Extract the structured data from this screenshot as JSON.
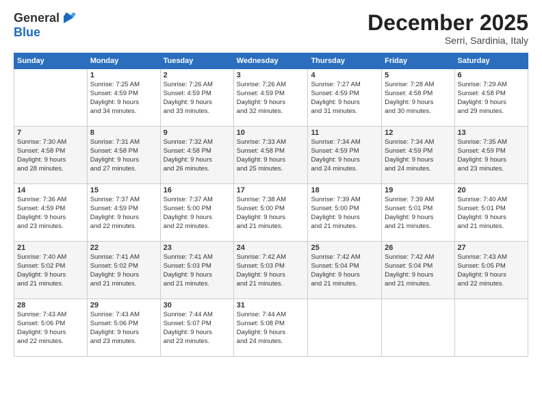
{
  "header": {
    "logo_line1": "General",
    "logo_line2": "Blue",
    "month": "December 2025",
    "location": "Serri, Sardinia, Italy"
  },
  "weekdays": [
    "Sunday",
    "Monday",
    "Tuesday",
    "Wednesday",
    "Thursday",
    "Friday",
    "Saturday"
  ],
  "weeks": [
    [
      {
        "day": "",
        "info": ""
      },
      {
        "day": "1",
        "info": "Sunrise: 7:25 AM\nSunset: 4:59 PM\nDaylight: 9 hours\nand 34 minutes."
      },
      {
        "day": "2",
        "info": "Sunrise: 7:26 AM\nSunset: 4:59 PM\nDaylight: 9 hours\nand 33 minutes."
      },
      {
        "day": "3",
        "info": "Sunrise: 7:26 AM\nSunset: 4:59 PM\nDaylight: 9 hours\nand 32 minutes."
      },
      {
        "day": "4",
        "info": "Sunrise: 7:27 AM\nSunset: 4:59 PM\nDaylight: 9 hours\nand 31 minutes."
      },
      {
        "day": "5",
        "info": "Sunrise: 7:28 AM\nSunset: 4:58 PM\nDaylight: 9 hours\nand 30 minutes."
      },
      {
        "day": "6",
        "info": "Sunrise: 7:29 AM\nSunset: 4:58 PM\nDaylight: 9 hours\nand 29 minutes."
      }
    ],
    [
      {
        "day": "7",
        "info": "Sunrise: 7:30 AM\nSunset: 4:58 PM\nDaylight: 9 hours\nand 28 minutes."
      },
      {
        "day": "8",
        "info": "Sunrise: 7:31 AM\nSunset: 4:58 PM\nDaylight: 9 hours\nand 27 minutes."
      },
      {
        "day": "9",
        "info": "Sunrise: 7:32 AM\nSunset: 4:58 PM\nDaylight: 9 hours\nand 26 minutes."
      },
      {
        "day": "10",
        "info": "Sunrise: 7:33 AM\nSunset: 4:58 PM\nDaylight: 9 hours\nand 25 minutes."
      },
      {
        "day": "11",
        "info": "Sunrise: 7:34 AM\nSunset: 4:59 PM\nDaylight: 9 hours\nand 24 minutes."
      },
      {
        "day": "12",
        "info": "Sunrise: 7:34 AM\nSunset: 4:59 PM\nDaylight: 9 hours\nand 24 minutes."
      },
      {
        "day": "13",
        "info": "Sunrise: 7:35 AM\nSunset: 4:59 PM\nDaylight: 9 hours\nand 23 minutes."
      }
    ],
    [
      {
        "day": "14",
        "info": "Sunrise: 7:36 AM\nSunset: 4:59 PM\nDaylight: 9 hours\nand 23 minutes."
      },
      {
        "day": "15",
        "info": "Sunrise: 7:37 AM\nSunset: 4:59 PM\nDaylight: 9 hours\nand 22 minutes."
      },
      {
        "day": "16",
        "info": "Sunrise: 7:37 AM\nSunset: 5:00 PM\nDaylight: 9 hours\nand 22 minutes."
      },
      {
        "day": "17",
        "info": "Sunrise: 7:38 AM\nSunset: 5:00 PM\nDaylight: 9 hours\nand 21 minutes."
      },
      {
        "day": "18",
        "info": "Sunrise: 7:39 AM\nSunset: 5:00 PM\nDaylight: 9 hours\nand 21 minutes."
      },
      {
        "day": "19",
        "info": "Sunrise: 7:39 AM\nSunset: 5:01 PM\nDaylight: 9 hours\nand 21 minutes."
      },
      {
        "day": "20",
        "info": "Sunrise: 7:40 AM\nSunset: 5:01 PM\nDaylight: 9 hours\nand 21 minutes."
      }
    ],
    [
      {
        "day": "21",
        "info": "Sunrise: 7:40 AM\nSunset: 5:02 PM\nDaylight: 9 hours\nand 21 minutes."
      },
      {
        "day": "22",
        "info": "Sunrise: 7:41 AM\nSunset: 5:02 PM\nDaylight: 9 hours\nand 21 minutes."
      },
      {
        "day": "23",
        "info": "Sunrise: 7:41 AM\nSunset: 5:03 PM\nDaylight: 9 hours\nand 21 minutes."
      },
      {
        "day": "24",
        "info": "Sunrise: 7:42 AM\nSunset: 5:03 PM\nDaylight: 9 hours\nand 21 minutes."
      },
      {
        "day": "25",
        "info": "Sunrise: 7:42 AM\nSunset: 5:04 PM\nDaylight: 9 hours\nand 21 minutes."
      },
      {
        "day": "26",
        "info": "Sunrise: 7:42 AM\nSunset: 5:04 PM\nDaylight: 9 hours\nand 21 minutes."
      },
      {
        "day": "27",
        "info": "Sunrise: 7:43 AM\nSunset: 5:05 PM\nDaylight: 9 hours\nand 22 minutes."
      }
    ],
    [
      {
        "day": "28",
        "info": "Sunrise: 7:43 AM\nSunset: 5:06 PM\nDaylight: 9 hours\nand 22 minutes."
      },
      {
        "day": "29",
        "info": "Sunrise: 7:43 AM\nSunset: 5:06 PM\nDaylight: 9 hours\nand 23 minutes."
      },
      {
        "day": "30",
        "info": "Sunrise: 7:44 AM\nSunset: 5:07 PM\nDaylight: 9 hours\nand 23 minutes."
      },
      {
        "day": "31",
        "info": "Sunrise: 7:44 AM\nSunset: 5:08 PM\nDaylight: 9 hours\nand 24 minutes."
      },
      {
        "day": "",
        "info": ""
      },
      {
        "day": "",
        "info": ""
      },
      {
        "day": "",
        "info": ""
      }
    ]
  ]
}
